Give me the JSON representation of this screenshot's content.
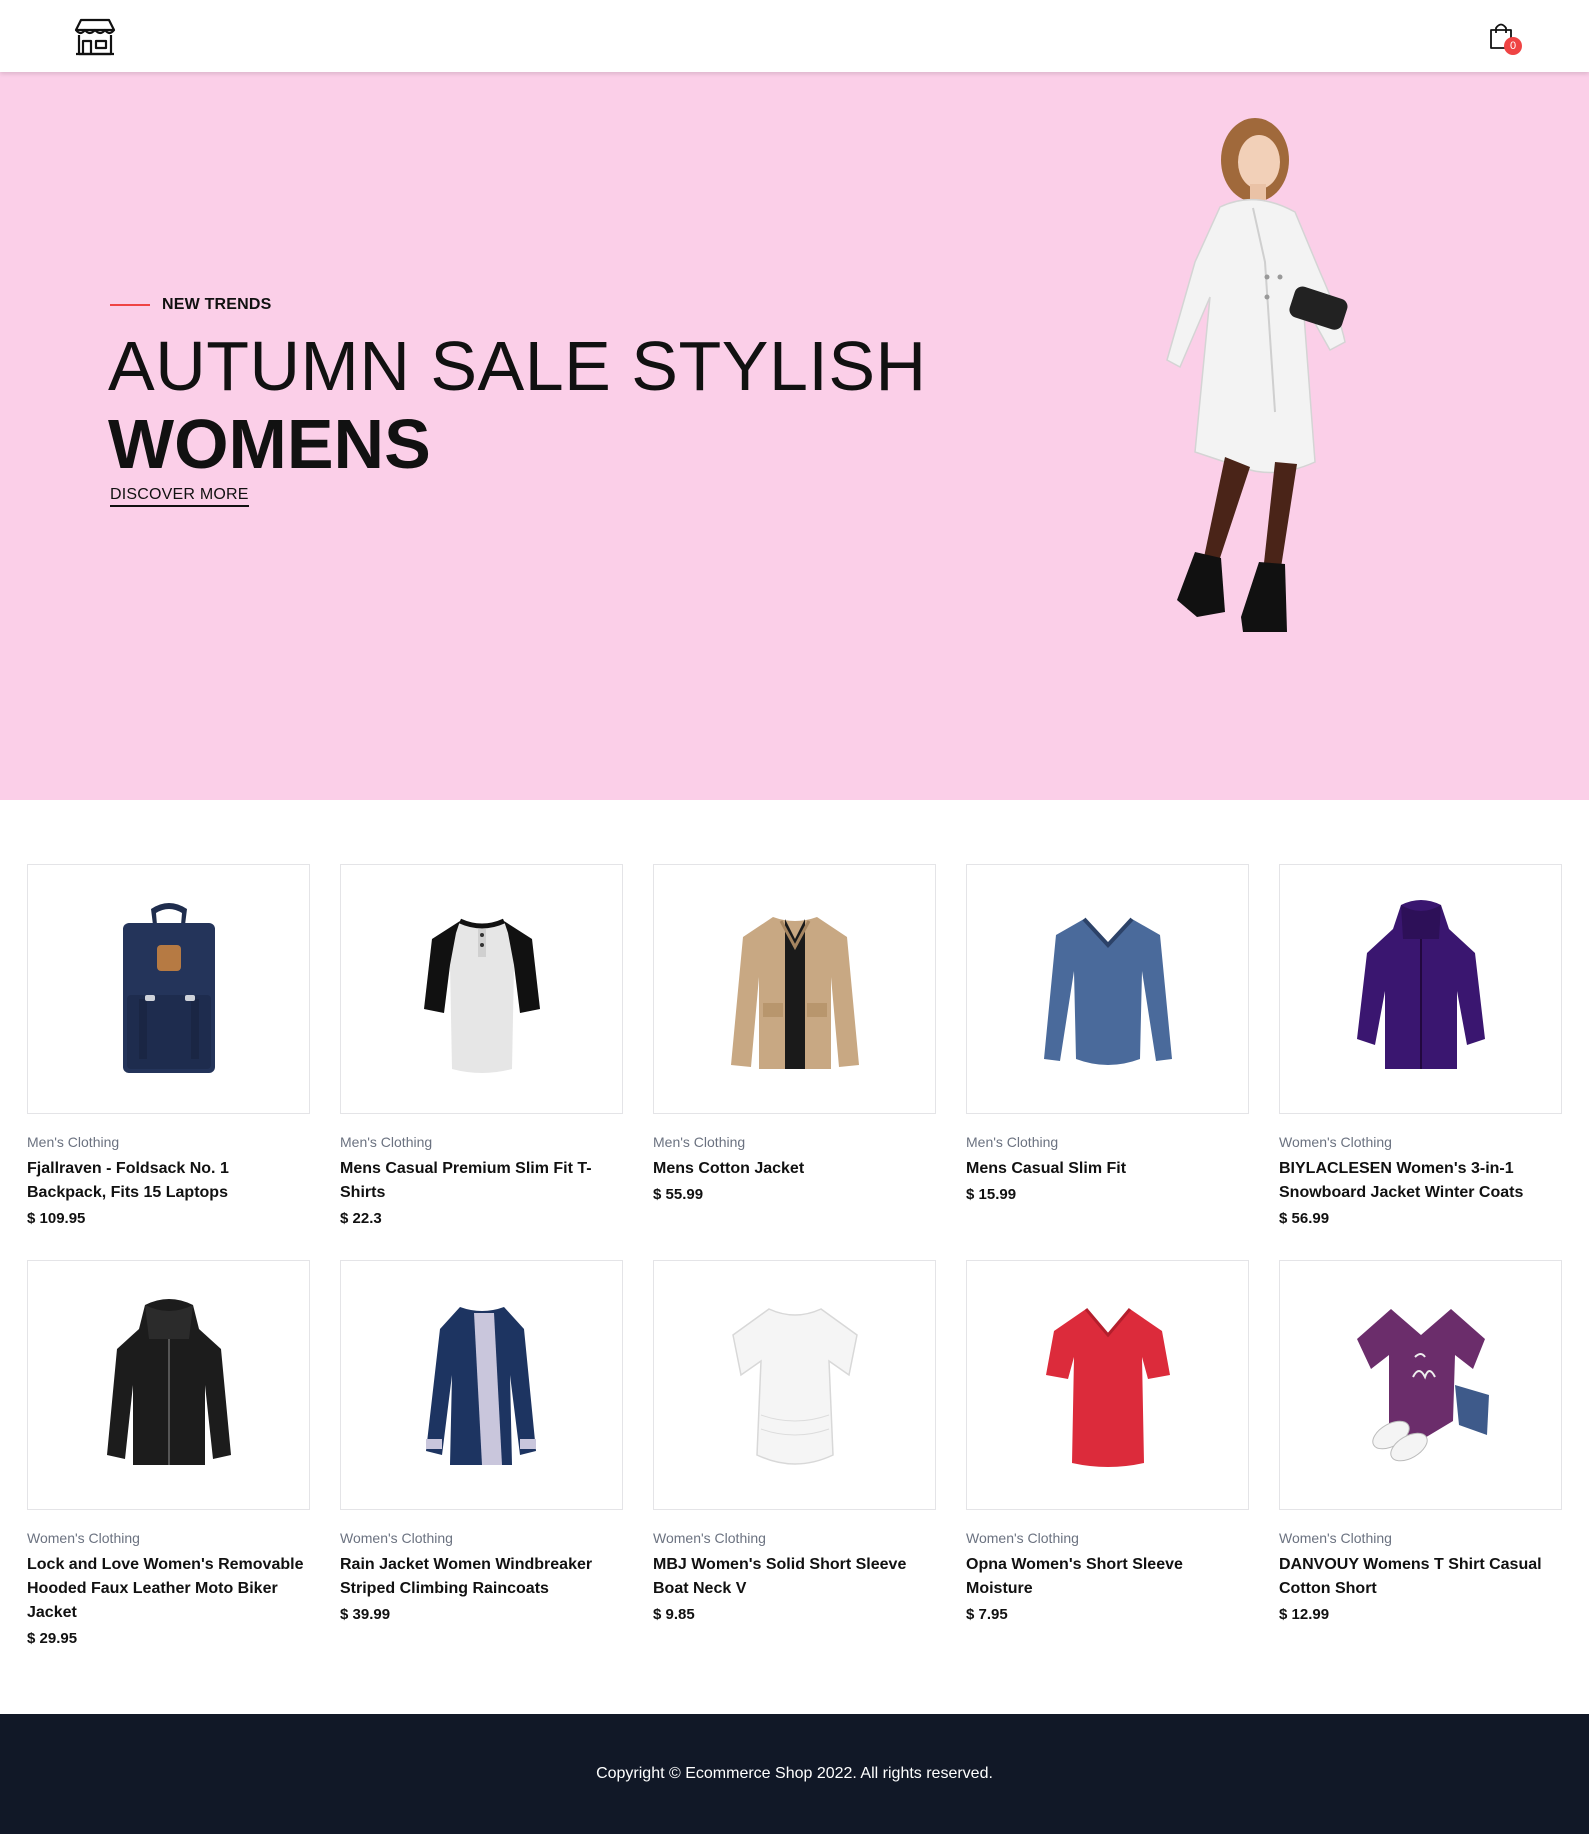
{
  "colors": {
    "hero_bg": "#fbcfe8",
    "accent": "#ef4444",
    "badge": "#ef4444",
    "footer_bg": "#111827"
  },
  "header": {
    "logo_icon": "storefront-icon",
    "cart_icon": "shopping-bag-icon",
    "cart_count": "0"
  },
  "hero": {
    "eyebrow": "NEW TRENDS",
    "title_light": "AUTUMN SALE STYLISH",
    "title_bold": "WOMENS",
    "cta": "DISCOVER MORE",
    "image": "woman-in-white-coat"
  },
  "products": [
    {
      "category": "Men's Clothing",
      "title": "Fjallraven - Foldsack No. 1 Backpack, Fits 15 Laptops",
      "price": "$ 109.95",
      "image": "navy-backpack"
    },
    {
      "category": "Men's Clothing",
      "title": "Mens Casual Premium Slim Fit T-Shirts",
      "price": "$ 22.3",
      "image": "raglan-tshirt"
    },
    {
      "category": "Men's Clothing",
      "title": "Mens Cotton Jacket",
      "price": "$ 55.99",
      "image": "tan-jacket"
    },
    {
      "category": "Men's Clothing",
      "title": "Mens Casual Slim Fit",
      "price": "$ 15.99",
      "image": "blue-longsleeve"
    },
    {
      "category": "Women's Clothing",
      "title": "BIYLACLESEN Women's 3-in-1 Snowboard Jacket Winter Coats",
      "price": "$ 56.99",
      "image": "purple-snow-jacket"
    },
    {
      "category": "Women's Clothing",
      "title": "Lock and Love Women's Removable Hooded Faux Leather Moto Biker Jacket",
      "price": "$ 29.95",
      "image": "black-leather-jacket"
    },
    {
      "category": "Women's Clothing",
      "title": "Rain Jacket Women Windbreaker Striped Climbing Raincoats",
      "price": "$ 39.99",
      "image": "navy-raincoat"
    },
    {
      "category": "Women's Clothing",
      "title": "MBJ Women's Solid Short Sleeve Boat Neck V",
      "price": "$ 9.85",
      "image": "white-top"
    },
    {
      "category": "Women's Clothing",
      "title": "Opna Women's Short Sleeve Moisture",
      "price": "$ 7.95",
      "image": "red-vneck"
    },
    {
      "category": "Women's Clothing",
      "title": "DANVOUY Womens T Shirt Casual Cotton Short",
      "price": "$ 12.99",
      "image": "purple-be-kind-tee"
    }
  ],
  "footer": {
    "copyright": "Copyright © Ecommerce Shop 2022. All rights reserved."
  }
}
